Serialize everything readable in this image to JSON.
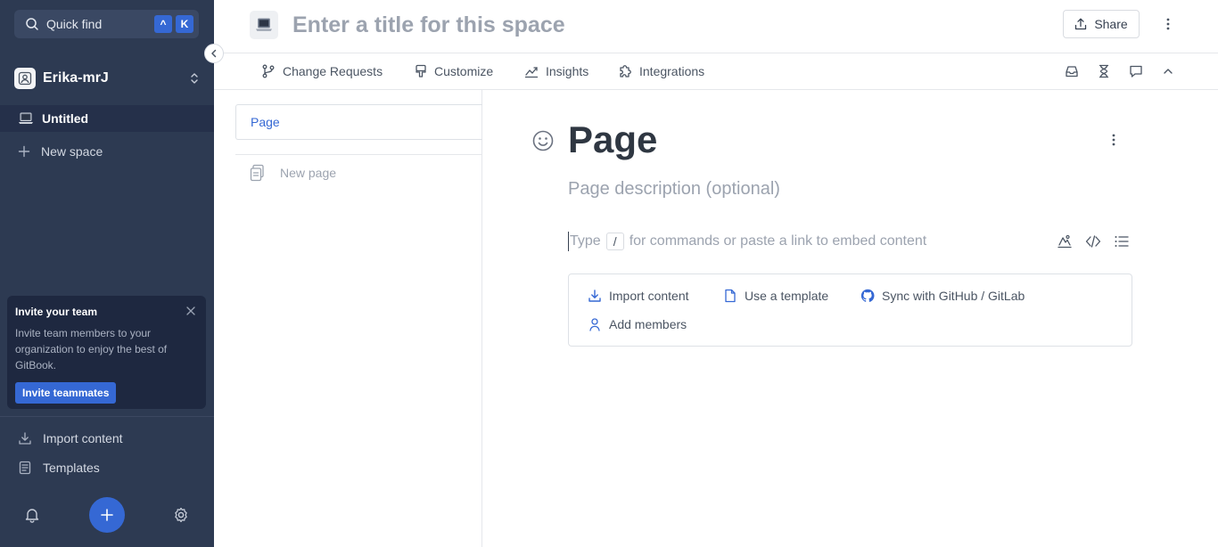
{
  "sidebar": {
    "quickfind": {
      "label": "Quick find",
      "keys": [
        "^",
        "K"
      ]
    },
    "org_name": "Erika-mrJ",
    "spaces": [
      {
        "label": "Untitled",
        "icon": "laptop-icon"
      }
    ],
    "new_space_label": "New space",
    "invite": {
      "title": "Invite your team",
      "text": "Invite team members to your organization to enjoy the best of GitBook.",
      "button": "Invite teammates"
    },
    "links": [
      {
        "label": "Import content",
        "icon": "download-icon"
      },
      {
        "label": "Templates",
        "icon": "templates-icon"
      }
    ]
  },
  "header": {
    "title_placeholder": "Enter a title for this space",
    "share_label": "Share"
  },
  "toolbar": {
    "items": [
      {
        "label": "Change Requests",
        "icon": "branch-icon"
      },
      {
        "label": "Customize",
        "icon": "paintbrush-icon"
      },
      {
        "label": "Insights",
        "icon": "chart-icon"
      },
      {
        "label": "Integrations",
        "icon": "puzzle-icon"
      }
    ]
  },
  "pages": {
    "items": [
      {
        "label": "Page"
      }
    ],
    "new_page_label": "New page"
  },
  "editor": {
    "title": "Page",
    "description_placeholder": "Page description (optional)",
    "type_prefix": "Type",
    "type_key": "/",
    "type_suffix": "for commands or paste a link to embed content",
    "actions": [
      {
        "label": "Import content",
        "icon": "import-icon"
      },
      {
        "label": "Use a template",
        "icon": "file-icon"
      },
      {
        "label": "Sync with GitHub / GitLab",
        "icon": "github-icon"
      },
      {
        "label": "Add members",
        "icon": "user-icon"
      }
    ]
  },
  "colors": {
    "sidebar_bg": "#2d3a52",
    "accent": "#3568d4"
  }
}
